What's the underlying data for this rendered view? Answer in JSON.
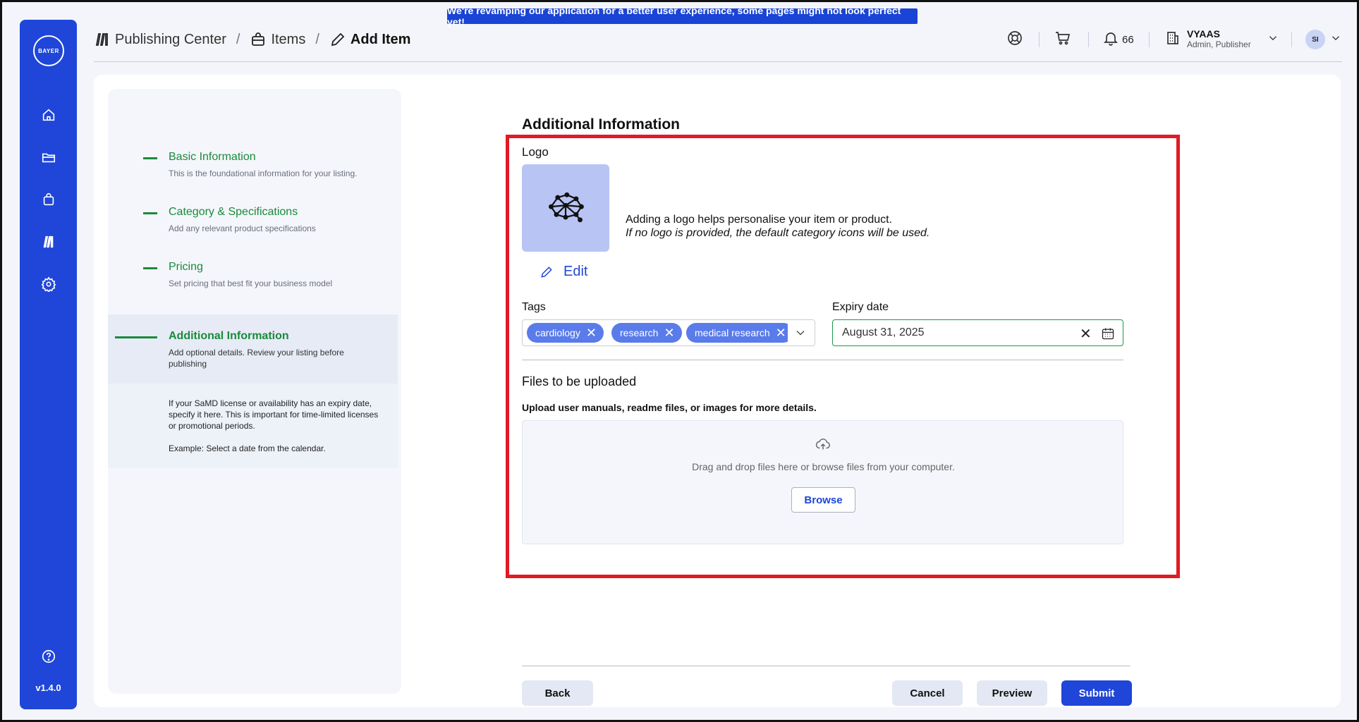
{
  "banner": {
    "text": "We're revamping our application for a better user experience, some pages might not look perfect yet!"
  },
  "sidebar": {
    "logo_text": "BAYER",
    "version": "v1.4.0"
  },
  "breadcrumb": {
    "items": [
      {
        "label": "Publishing Center"
      },
      {
        "label": "Items"
      },
      {
        "label": "Add Item"
      }
    ],
    "separator": "/"
  },
  "header": {
    "notifications_count": "66",
    "org_name": "VYAAS",
    "org_role": "Admin, Publisher",
    "avatar_initials": "SI"
  },
  "steps": [
    {
      "title": "Basic Information",
      "desc": "This is the foundational information for your listing."
    },
    {
      "title": "Category & Specifications",
      "desc": "Add any relevant product specifications"
    },
    {
      "title": "Pricing",
      "desc": "Set pricing that best fit your business model"
    },
    {
      "title": "Additional Information",
      "desc": "Add optional details. Review your listing before publishing"
    }
  ],
  "help": {
    "line1": "If your SaMD license or availability has an expiry date, specify it here. This is important for time-limited licenses or promotional periods.",
    "line2": "Example: Select a date from the calendar."
  },
  "form": {
    "section_title": "Additional Information",
    "logo_label": "Logo",
    "logo_hint": "Adding a logo helps personalise your item or product.",
    "logo_hint_italic": "If no logo is provided, the default category icons will be used.",
    "edit_label": "Edit",
    "tags_label": "Tags",
    "tags": [
      "cardiology",
      "research",
      "medical research"
    ],
    "expiry_label": "Expiry date",
    "expiry_value": "August 31, 2025",
    "files_title": "Files to be uploaded",
    "files_subtitle": "Upload user manuals, readme files, or images for more details.",
    "drop_text": "Drag and drop files here or browse files from your computer.",
    "browse_label": "Browse"
  },
  "footer": {
    "back": "Back",
    "cancel": "Cancel",
    "preview": "Preview",
    "submit": "Submit"
  },
  "colors": {
    "brand_blue": "#1f46d8",
    "step_green": "#1a8a3a",
    "highlight_red": "#e01b24"
  }
}
